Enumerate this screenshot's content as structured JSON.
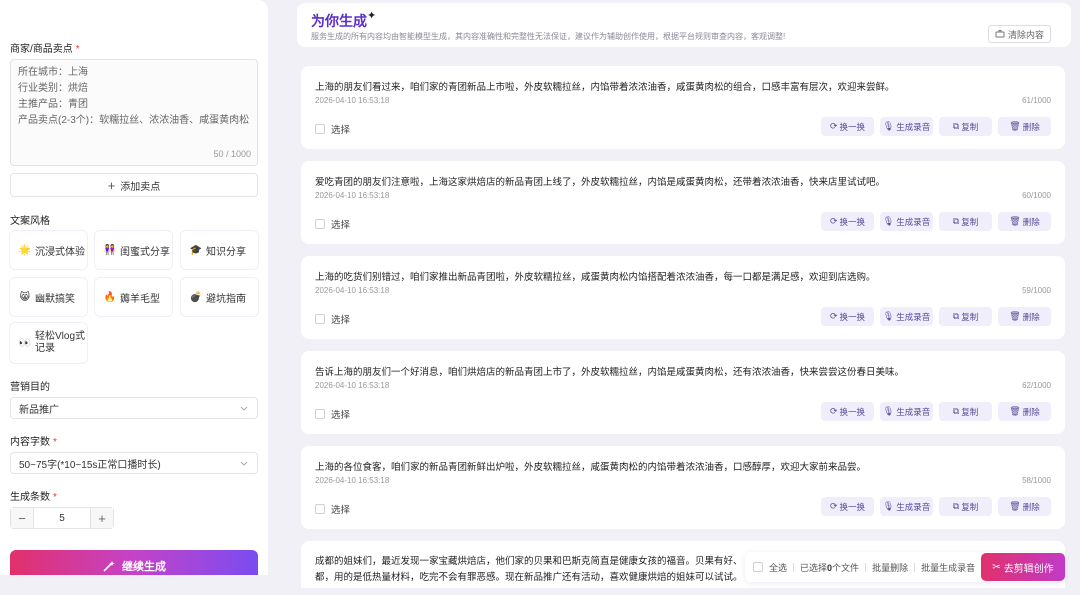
{
  "left": {
    "product_label": "商家/商品卖点",
    "product_lines": [
      "所在城市：上海",
      "行业类别：烘焙",
      "主推产品：青团",
      "产品卖点(2-3个)：软糯拉丝、浓浓油香、咸蛋黄肉松"
    ],
    "product_count": "50 / 1000",
    "add_selling_point": "添加卖点",
    "style_label": "文案风格",
    "styles": [
      {
        "emoji": "🌟",
        "label": "沉浸式体验"
      },
      {
        "emoji": "👭",
        "label": "闺蜜式分享"
      },
      {
        "emoji": "🎓",
        "label": "知识分享"
      },
      {
        "emoji": "😸",
        "label": "幽默搞笑"
      },
      {
        "emoji": "🔥",
        "label": "薅羊毛型"
      },
      {
        "emoji": "💣",
        "label": "避坑指南"
      },
      {
        "emoji": "👀",
        "label": "轻松Vlog式记录"
      }
    ],
    "purpose_label": "营销目的",
    "purpose_value": "新品推广",
    "length_label": "内容字数",
    "length_value": "50~75字(*10~15s正常口播时长)",
    "count_label": "生成条数",
    "count_value": "5",
    "generate_button": "继续生成"
  },
  "header": {
    "title": "为你生成",
    "subtitle": "服务生成的所有内容均由智能模型生成，其内容准确性和完整性无法保证，建议作为辅助创作使用，根据平台规则审查内容，客观调整!",
    "clear_button": "清除内容"
  },
  "actions": {
    "regen": "换一换",
    "voice": "生成录音",
    "copy": "复制",
    "delete": "删除",
    "select": "选择"
  },
  "results": [
    {
      "text": "上海的朋友们看过来，咱们家的青团新品上市啦，外皮软糯拉丝，内馅带着浓浓油香，咸蛋黄肉松的组合，口感丰富有层次，欢迎来尝鲜。",
      "time": "2026-04-10 16:53:18",
      "count": "61/1000"
    },
    {
      "text": "爱吃青团的朋友们注意啦，上海这家烘焙店的新品青团上线了，外皮软糯拉丝，内馅是咸蛋黄肉松，还带着浓浓油香，快来店里试试吧。",
      "time": "2026-04-10 16:53:18",
      "count": "60/1000"
    },
    {
      "text": "上海的吃货们别错过，咱们家推出新品青团啦，外皮软糯拉丝，咸蛋黄肉松内馅搭配着浓浓油香，每一口都是满足感，欢迎到店选购。",
      "time": "2026-04-10 16:53:18",
      "count": "59/1000"
    },
    {
      "text": "告诉上海的朋友们一个好消息，咱们烘焙店的新品青团上市了，外皮软糯拉丝，内馅是咸蛋黄肉松，还有浓浓油香，快来尝尝这份春日美味。",
      "time": "2026-04-10 16:53:18",
      "count": "62/1000"
    },
    {
      "text": "上海的各位食客，咱们家的新品青团新鲜出炉啦，外皮软糯拉丝，咸蛋黄肉松的内馅带着浓浓油香，口感醇厚，欢迎大家前来品尝。",
      "time": "2026-04-10 16:53:18",
      "count": "58/1000"
    },
    {
      "text": "成都的姐妹们，最近发现一家宝藏烘焙店，他们家的贝果和巴斯克简直是健康女孩的福音。贝果有好、都，用的是低热量材料，吃完不会有罪恶感。现在新品推广还有活动，喜欢健康烘焙的姐妹可以试试。",
      "time": "",
      "count": ""
    }
  ],
  "bottom_bar": {
    "select_all": "全选",
    "selected_prefix": "已选择",
    "selected_count": "0",
    "selected_suffix": "个文件",
    "batch_delete": "批量删除",
    "batch_voice": "批量生成录音",
    "edit_button": "去剪辑创作"
  }
}
